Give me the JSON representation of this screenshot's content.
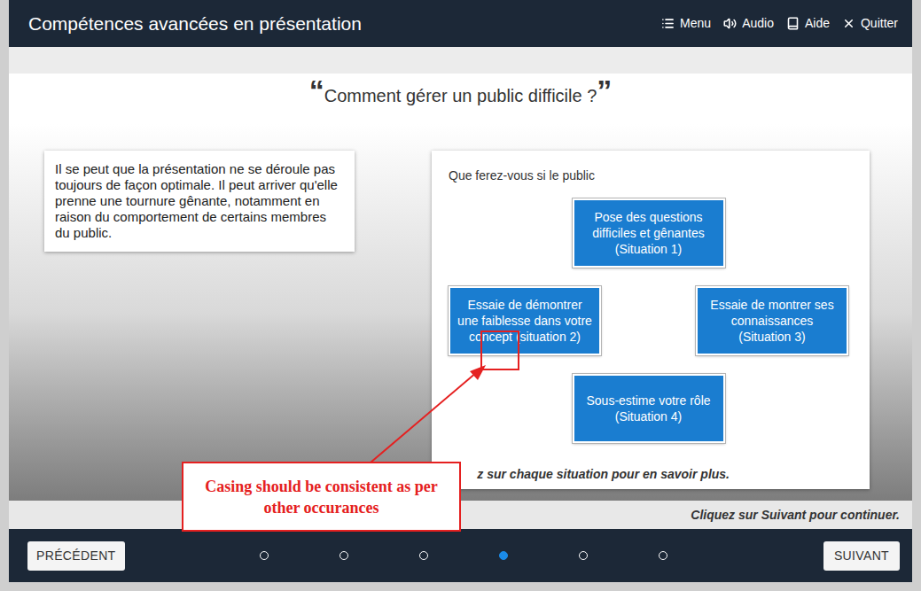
{
  "header": {
    "title": "Compétences avancées en présentation",
    "menu": [
      {
        "label": "Menu"
      },
      {
        "label": "Audio"
      },
      {
        "label": "Aide"
      },
      {
        "label": "Quitter"
      }
    ]
  },
  "slide": {
    "quote_open": "“",
    "title": "Comment gérer un public difficile ?",
    "quote_close": "”",
    "intro": "Il se peut que la présentation ne se déroule pas toujours de façon optimale. Il peut arriver qu'elle prenne une tournure gênante, notamment en raison du comportement de certains membres du public.",
    "panel": {
      "prompt": "Que ferez-vous si le public",
      "situations": [
        {
          "label": "Pose des questions difficiles et gênantes (Situation 1)"
        },
        {
          "label": "Essaie de démontrer une faiblesse dans votre concept (situation 2)"
        },
        {
          "label": "Essaie de montrer ses connaissances (Situation 3)"
        },
        {
          "label": "Sous-estime votre rôle (Situation 4)"
        }
      ],
      "hint": "z sur chaque situation pour en savoir plus."
    }
  },
  "footer_hint": "Cliquez sur Suivant pour continuer.",
  "nav": {
    "previous": "PRÉCÉDENT",
    "next": "SUIVANT",
    "pages": [
      {
        "selected": false
      },
      {
        "selected": false
      },
      {
        "selected": false
      },
      {
        "selected": true
      },
      {
        "selected": false
      },
      {
        "selected": false
      }
    ]
  },
  "annotation": {
    "text": "Casing should be consistent as per other occurances"
  }
}
